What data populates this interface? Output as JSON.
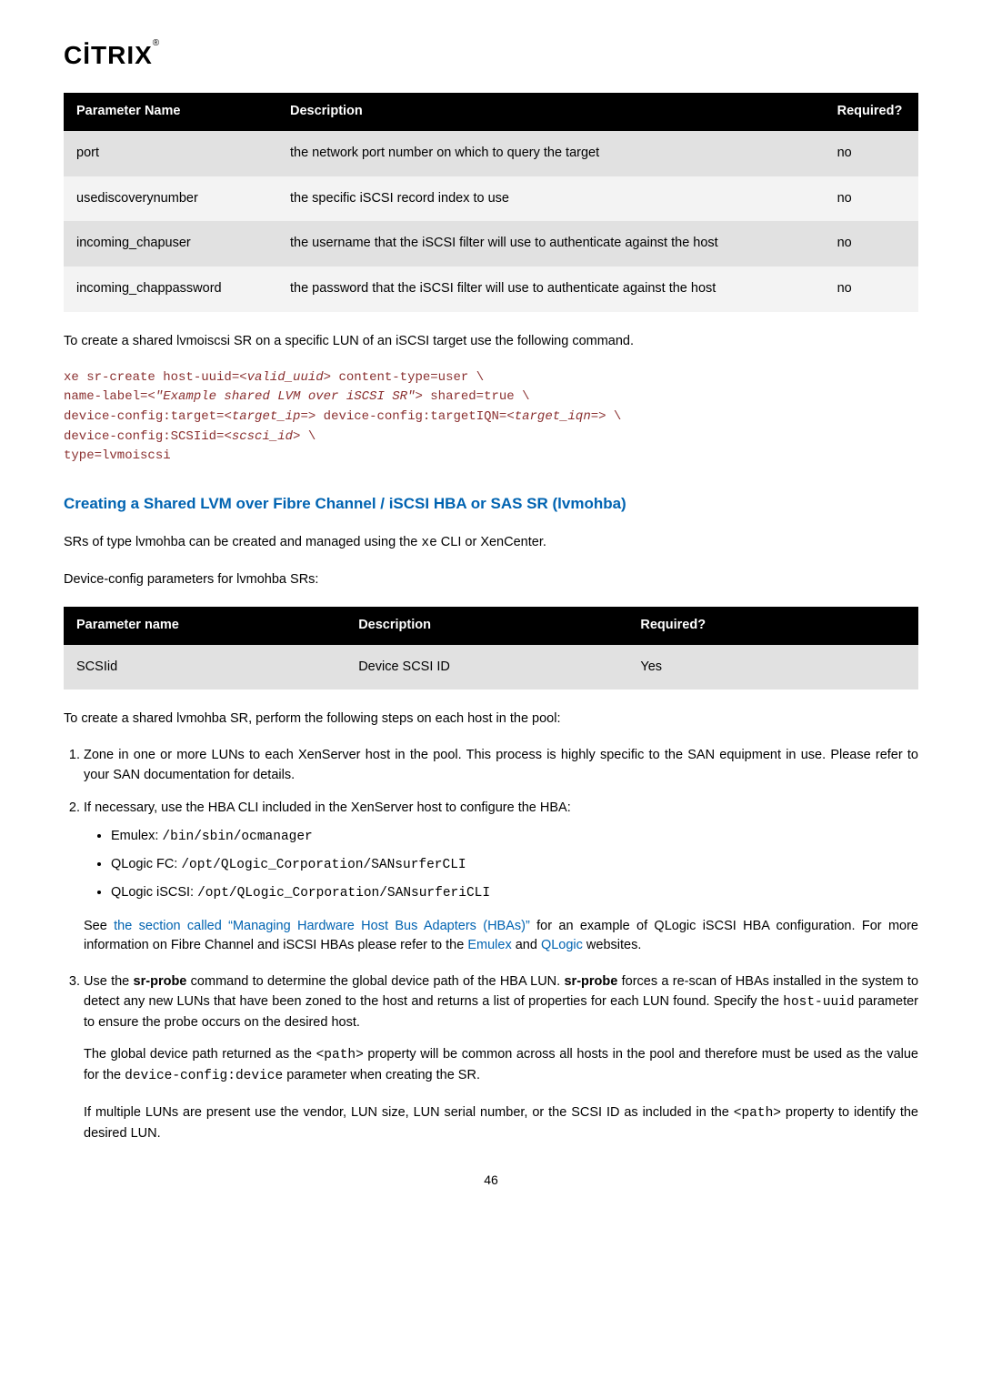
{
  "logo": {
    "text": "CİTRIX",
    "reg": "®"
  },
  "table1": {
    "headers": {
      "param": "Parameter Name",
      "desc": "Description",
      "req": "Required?"
    },
    "rows": [
      {
        "param": "port",
        "desc": "the network port number on which to query the target",
        "req": "no"
      },
      {
        "param": "usediscoverynumber",
        "desc": "the specific iSCSI record index to use",
        "req": "no"
      },
      {
        "param": "incoming_chapuser",
        "desc": "the username that the iSCSI filter will use to authenticate against the host",
        "req": "no"
      },
      {
        "param": "incoming_chappassword",
        "desc": "the password that the iSCSI filter will use to authenticate against the host",
        "req": "no"
      }
    ]
  },
  "intro1": "To create a shared lvmoiscsi SR on a specific LUN of an iSCSI target use the following command.",
  "code": {
    "l1a": "xe sr-create host-uuid=",
    "l1b": "<valid_uuid>",
    "l1c": " content-type=user \\",
    "l2a": "name-label=",
    "l2b": "<\"Example shared LVM over iSCSI SR\">",
    "l2c": " shared=true \\",
    "l3a": "device-config:target=",
    "l3b": "<target_ip=>",
    "l3c": " device-config:targetIQN=",
    "l3d": "<target_iqn=>",
    "l3e": " \\",
    "l4a": "device-config:SCSIid=",
    "l4b": "<scsci_id>",
    "l4c": " \\",
    "l5": "type=lvmoiscsi"
  },
  "heading2": "Creating a Shared LVM over Fibre Channel / iSCSI HBA or SAS SR (lvmohba)",
  "para2a": "SRs of type lvmohba can be created and managed using the ",
  "para2a_mono": "xe",
  "para2a_end": " CLI or XenCenter.",
  "para2b": "Device-config parameters for lvmohba SRs:",
  "table2": {
    "headers": {
      "param": "Parameter name",
      "desc": "Description",
      "req": "Required?"
    },
    "rows": [
      {
        "param": "SCSIid",
        "desc": "Device SCSI ID",
        "req": "Yes"
      }
    ]
  },
  "intro3": "To create a shared lvmohba SR, perform the following steps on each host in the pool:",
  "li1": "Zone in one or more LUNs to each XenServer host in the pool. This process is highly specific to the SAN equipment in use. Please refer to your SAN documentation for details.",
  "li2": "If necessary, use the HBA CLI included in the XenServer host to configure the HBA:",
  "bullets": {
    "b1_label": "Emulex: ",
    "b1_code": "/bin/sbin/ocmanager",
    "b2_label": "QLogic FC: ",
    "b2_code": "/opt/QLogic_Corporation/SANsurferCLI",
    "b3_label": "QLogic iSCSI: ",
    "b3_code": "/opt/QLogic_Corporation/SANsurferiCLI"
  },
  "li2_after_a": "See ",
  "li2_link": "the section called “Managing Hardware Host Bus Adapters (HBAs)”",
  "li2_after_b": " for an example of QLogic iSCSI HBA configuration. For more information on Fibre Channel and iSCSI HBAs please refer to the ",
  "li2_link2": "Emulex",
  "li2_after_c": " and ",
  "li2_link3": "QLogic",
  "li2_after_d": " websites.",
  "li3_a": "Use the ",
  "li3_b": "sr-probe",
  "li3_c": " command to determine the global device path of the HBA LUN. ",
  "li3_d": "sr-probe",
  "li3_e": " forces a re-scan of HBAs installed in the system to detect any new LUNs that have been zoned to the host and returns a list of properties for each LUN found. Specify the ",
  "li3_f": "host-uuid",
  "li3_g": " parameter to ensure the probe occurs on the desired host.",
  "li3_p2_a": "The global device path returned as the ",
  "li3_p2_b": "<path>",
  "li3_p2_c": " property will be common across all hosts in the pool and therefore must be used as the value for the ",
  "li3_p2_d": "device-config:device",
  "li3_p2_e": " parameter when creating the SR.",
  "li3_p3_a": "If multiple LUNs are present use the vendor, LUN size, LUN serial number, or the SCSI ID as included in the ",
  "li3_p3_b": "<path>",
  "li3_p3_c": " property to identify the desired LUN.",
  "pagenum": "46"
}
